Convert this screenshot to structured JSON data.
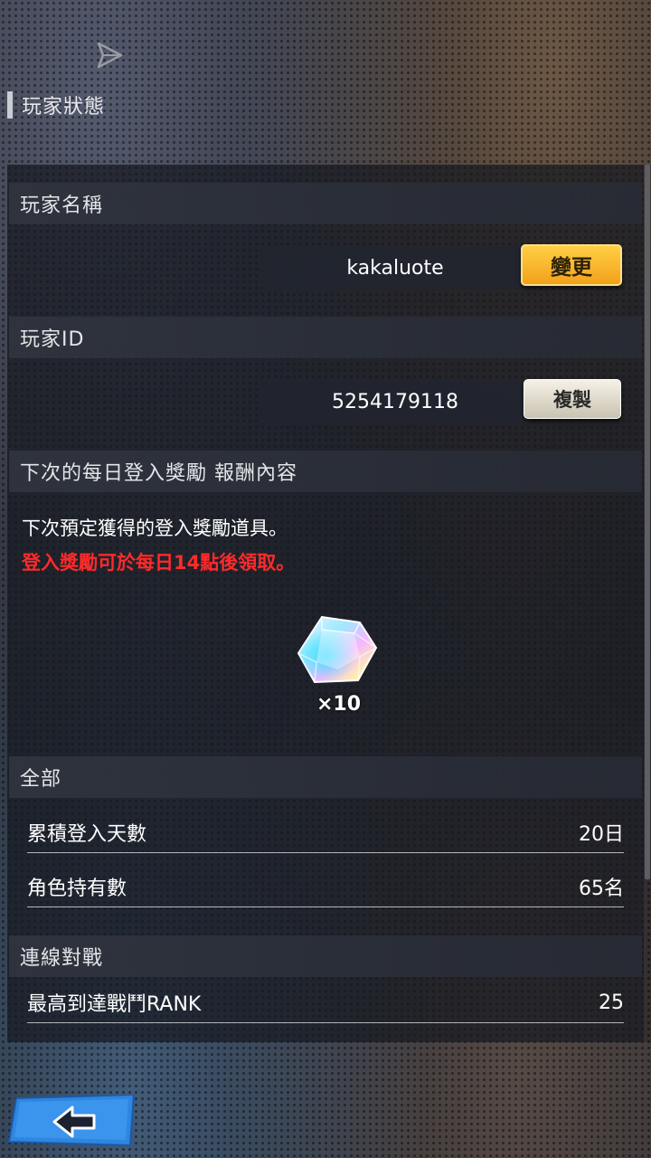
{
  "header": {
    "title": "玩家狀態"
  },
  "sections": {
    "player_name": {
      "heading": "玩家名稱",
      "value": "kakaluote",
      "button": "變更"
    },
    "player_id": {
      "heading": "玩家ID",
      "value": "5254179118",
      "button": "複製"
    },
    "login_bonus": {
      "heading": "下次的每日登入獎勵 報酬內容",
      "line1": "下次預定獲得的登入獎勵道具。",
      "line2": "登入獎勵可於每日14點後領取。",
      "reward_count": "×10",
      "reward_icon": "crystal-gem-icon"
    },
    "overall": {
      "heading": "全部",
      "rows": [
        {
          "label": "累積登入天數",
          "value": "20日"
        },
        {
          "label": "角色持有數",
          "value": "65名"
        }
      ]
    },
    "online_battle": {
      "heading": "連線對戰",
      "rows": [
        {
          "label": "最高到達戰鬥RANK",
          "value": "25"
        }
      ]
    }
  },
  "colors": {
    "accent_button": "#f7b22a",
    "warning_text": "#ff2a2a",
    "back_button": "#2f86e0"
  }
}
